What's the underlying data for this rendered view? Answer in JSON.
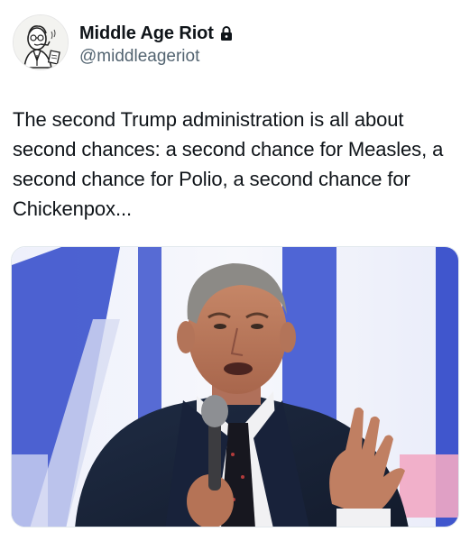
{
  "author": {
    "display_name": "Middle Age Riot",
    "handle": "@middleageriot",
    "avatar_icon": "cartoon-man-avatar-icon",
    "protected_icon": "lock-icon"
  },
  "tweet": {
    "text": "The second Trump administration is all about second chances: a second chance for Measles, a second chance for Polio, a second chance for Chickenpox..."
  },
  "media": {
    "type": "photo",
    "background_colors": [
      "#f6f7fb",
      "#2d45c8",
      "#e4e8f8",
      "#f2a9c4"
    ]
  }
}
